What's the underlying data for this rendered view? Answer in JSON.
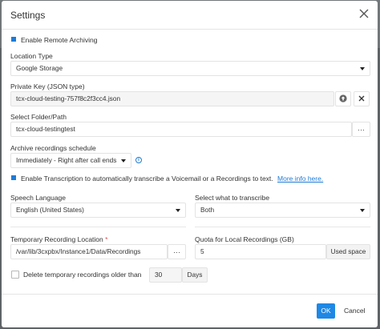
{
  "dialog": {
    "title": "Settings"
  },
  "enable_remote_archiving": {
    "label": "Enable Remote Archiving",
    "checked": true
  },
  "location_type": {
    "label": "Location Type",
    "value": "Google Storage"
  },
  "private_key": {
    "label": "Private Key (JSON type)",
    "value": "tcx-cloud-testing-757f8c2f3cc4.json",
    "upload_icon": "upload-circle-icon",
    "remove_icon": "close-icon"
  },
  "folder_path": {
    "label": "Select Folder/Path",
    "value": "tcx-cloud-testingtest",
    "browse_label": "···"
  },
  "archive_schedule": {
    "label": "Archive recordings schedule",
    "value": "Immediately - Right after call ends",
    "info_icon": "info-icon"
  },
  "transcription": {
    "label": "Enable Transcription to automatically transcribe a Voicemail or a Recordings to text.",
    "link": "More info here.",
    "checked": true
  },
  "speech_language": {
    "label": "Speech Language",
    "value": "English (United States)"
  },
  "transcribe_what": {
    "label": "Select what to transcribe",
    "value": "Both"
  },
  "temp_location": {
    "label": "Temporary Recording Location",
    "required_mark": "*",
    "value": "/var/lib/3cxpbx/Instance1/Data/Recordings",
    "browse_label": "···"
  },
  "quota": {
    "label": "Quota for Local Recordings (GB)",
    "value": "5",
    "addon": "Used space"
  },
  "delete_temp": {
    "label": "Delete temporary recordings older than",
    "days_value": "30",
    "days_unit": "Days",
    "checked": false
  },
  "footer": {
    "ok": "OK",
    "cancel": "Cancel"
  },
  "colors": {
    "accent": "#1e88e5",
    "link": "#1e7bd6"
  }
}
